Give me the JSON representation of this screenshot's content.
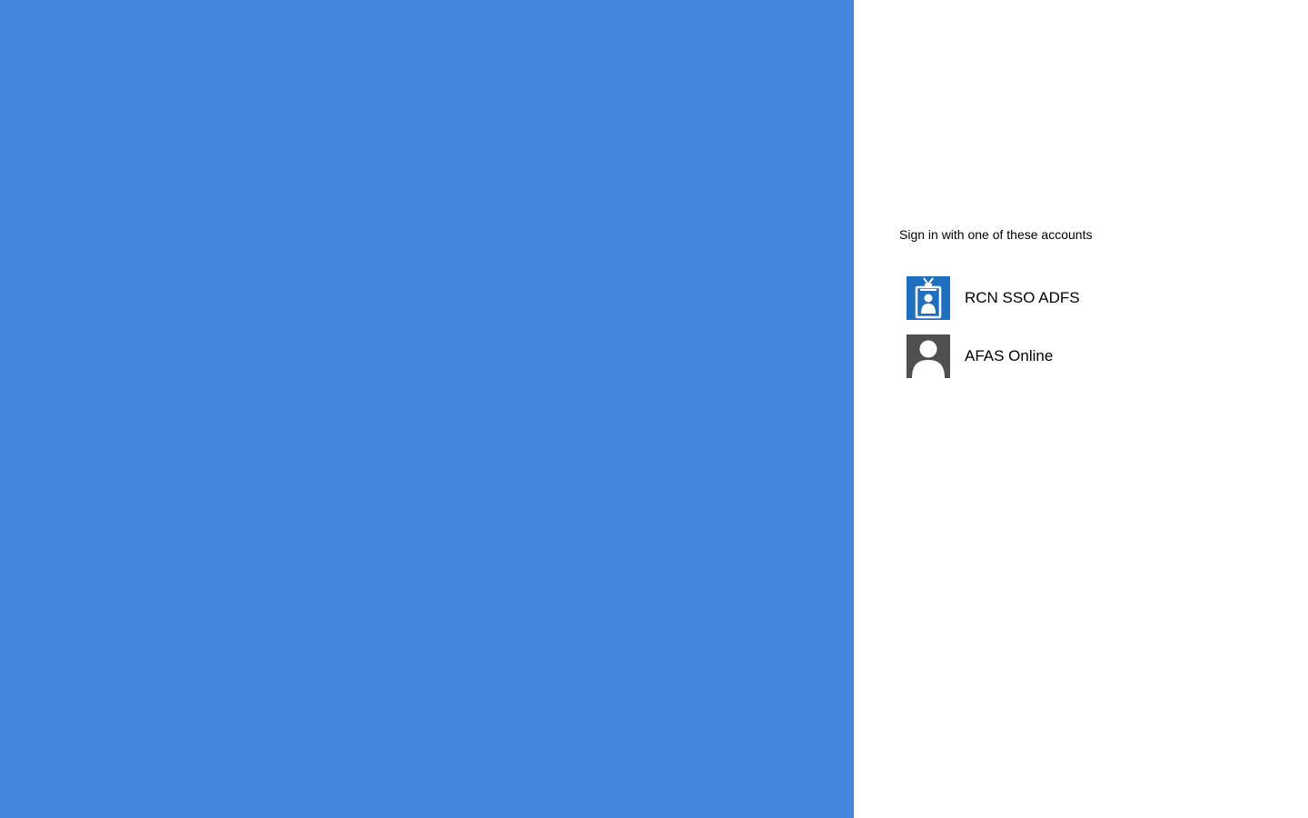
{
  "colors": {
    "background_panel": "#4587de",
    "page_background": "#ffffff",
    "adfs_tile": "#1e6fc2",
    "afas_tile": "#505050"
  },
  "signin": {
    "prompt": "Sign in with one of these accounts",
    "accounts": [
      {
        "label": "RCN SSO ADFS",
        "icon": "badge-icon"
      },
      {
        "label": "AFAS Online",
        "icon": "user-icon"
      }
    ]
  }
}
